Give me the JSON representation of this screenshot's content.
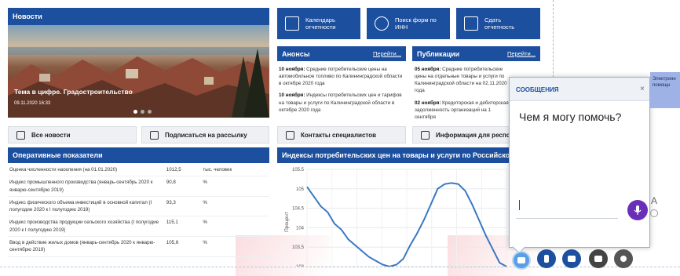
{
  "news": {
    "title": "Новости",
    "slide_caption": "Тема в цифре. Градостроительство",
    "slide_date": "09.11.2020 16:33"
  },
  "quick_links": [
    {
      "label": "Календарь отчетности",
      "icon": "calendar-icon"
    },
    {
      "label": "Поиск форм по ИНН",
      "icon": "search-icon"
    },
    {
      "label": "Сдать отчетность",
      "icon": "document-icon"
    }
  ],
  "announcements": {
    "title": "Анонсы",
    "more": "Перейти...",
    "items": [
      {
        "date": "10 ноября:",
        "text": "Средние потребительские цены на автомобильное топливо по Калининградской области в октябре 2020 года"
      },
      {
        "date": "10 ноября:",
        "text": "Индексы потребительских цен и тарифов на товары и услуги по Калининградской области в октябре 2020 года"
      }
    ]
  },
  "publications": {
    "title": "Публикации",
    "more": "Перейти...",
    "items": [
      {
        "date": "05 ноября:",
        "text": "Средние потребительские цены на отдельные товары и услуги по Калининградской области на 02.11.2020 года"
      },
      {
        "date": "02 ноября:",
        "text": "Кредиторская и дебиторская задолженность организаций на 1 сентября"
      }
    ]
  },
  "buttons": {
    "all_news": "Все новости",
    "subscribe": "Подписаться на рассылку",
    "contacts": "Контакты специалистов",
    "respondents": "Информация для респонд"
  },
  "indicators": {
    "title": "Оперативные показатели",
    "rows": [
      {
        "name": "Оценка численности населения (на 01.01.2020)",
        "value": "1012,5",
        "unit": "тыс. человек"
      },
      {
        "name": "Индекс промышленного производства (январь-сентябрь 2020 к январю-сентябрю 2019)",
        "value": "90,8",
        "unit": "%"
      },
      {
        "name": "Индекс физического объема инвестиций в основной капитал (I полугодие 2020 к I полугодию 2019)",
        "value": "93,3",
        "unit": "%"
      },
      {
        "name": "Индекс производства продукции сельского хозяйства (I полугодие 2020 к I полугодию 2019)",
        "value": "115,1",
        "unit": "%"
      },
      {
        "name": "Ввод в действие жилых домов (январь-сентябрь 2020 к январю-сентябрю 2019)",
        "value": "105,6",
        "unit": "%"
      }
    ]
  },
  "chart": {
    "title": "Индексы потребительских цен на товары и услуги по Российской Федера"
  },
  "chart_data": {
    "type": "line",
    "title": "Индексы потребительских цен на товары и услуги по Российской Федера",
    "ylabel": "Процент",
    "xlabel": "",
    "ylim": [
      103,
      105.5
    ],
    "yticks": [
      "105.5",
      "105",
      "104.5",
      "104",
      "103.5",
      "103"
    ],
    "grid": true,
    "series": [
      {
        "values": [
          105.05,
          104.8,
          104.55,
          104.4,
          104.1,
          103.95,
          103.7,
          103.55,
          103.4,
          103.25,
          103.15,
          103.05,
          103.0,
          103.05,
          103.2,
          103.55,
          103.85,
          104.2,
          104.6,
          105.0,
          105.12,
          105.15,
          105.12,
          104.95,
          104.6,
          104.2,
          103.8,
          103.45,
          103.1,
          103.0
        ]
      }
    ]
  },
  "chat": {
    "header": "СООБЩЕНИЯ",
    "close": "×",
    "greeting": "Чем я могу помочь?",
    "font_label": "A",
    "side_tab": "Электронн помощн"
  },
  "colors": {
    "brand": "#1d4f9f",
    "chat_mic": "#6a2fb8",
    "line": "#3a78c0"
  }
}
